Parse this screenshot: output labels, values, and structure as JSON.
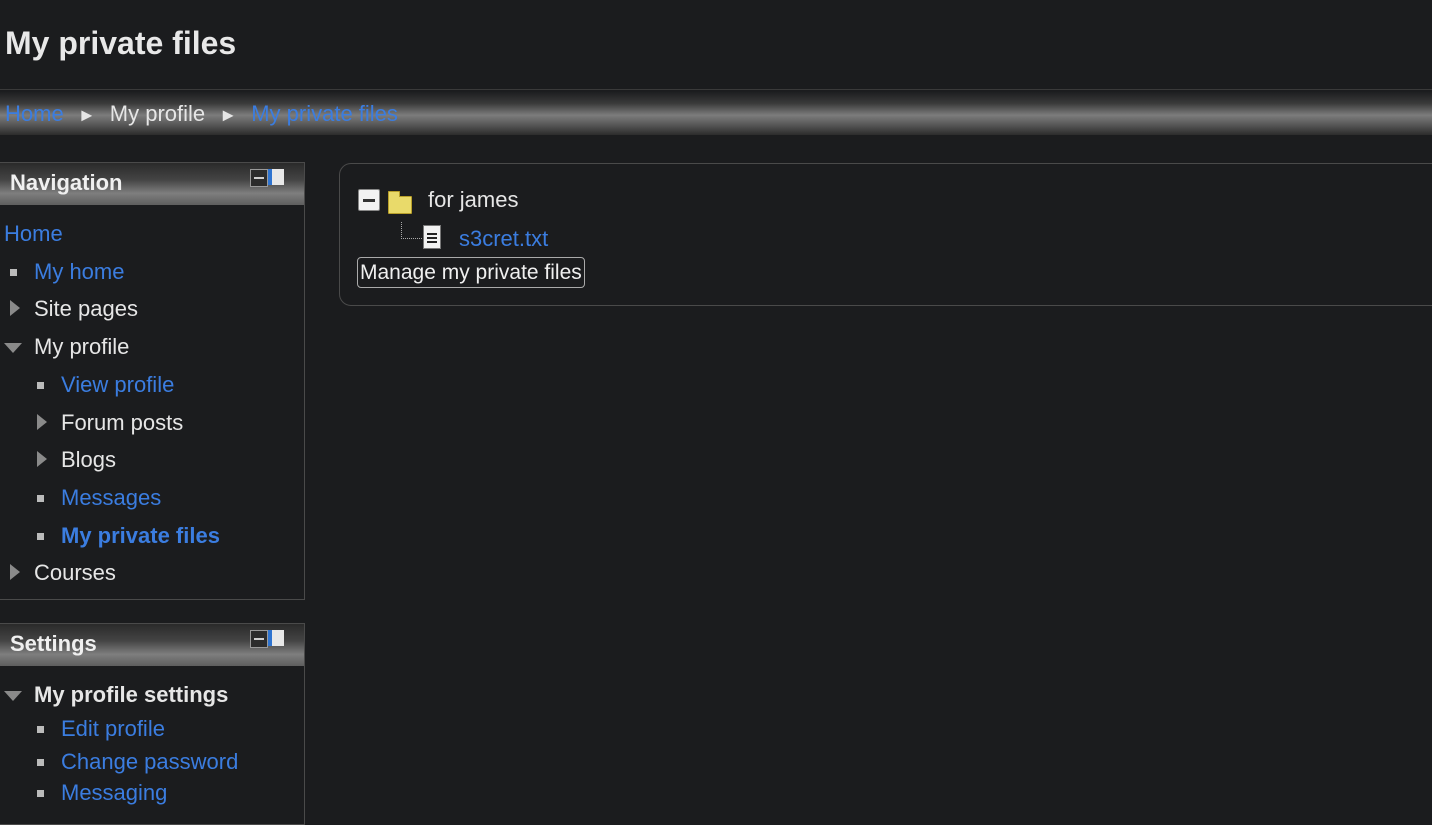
{
  "page": {
    "title": "My private files"
  },
  "breadcrumb": {
    "items": [
      "Home",
      "My profile",
      "My private files"
    ],
    "separator": "►"
  },
  "navigation": {
    "title": "Navigation",
    "items": [
      {
        "label": "Home",
        "link": true
      },
      {
        "label": "My home",
        "link": true
      },
      {
        "label": "Site pages",
        "link": false
      },
      {
        "label": "My profile",
        "link": false
      },
      {
        "label": "View profile",
        "link": true
      },
      {
        "label": "Forum posts",
        "link": false
      },
      {
        "label": "Blogs",
        "link": false
      },
      {
        "label": "Messages",
        "link": true
      },
      {
        "label": "My private files",
        "link": true
      },
      {
        "label": "Courses",
        "link": false
      }
    ]
  },
  "settings": {
    "title": "Settings",
    "items": [
      {
        "label": "My profile settings"
      },
      {
        "label": "Edit profile"
      },
      {
        "label": "Change password"
      },
      {
        "label": "Messaging"
      }
    ]
  },
  "files": {
    "folder": "for james",
    "file": "s3cret.txt",
    "manage_button": "Manage my private files"
  },
  "colors": {
    "background": "#1b1c1e",
    "link": "#3b7de0",
    "text": "#e6e6e6"
  }
}
